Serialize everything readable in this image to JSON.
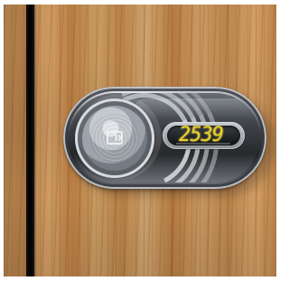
{
  "lock": {
    "display_value": "2539",
    "display_color": "#e8d12d",
    "reader_icon": "contactless-card-icon"
  }
}
